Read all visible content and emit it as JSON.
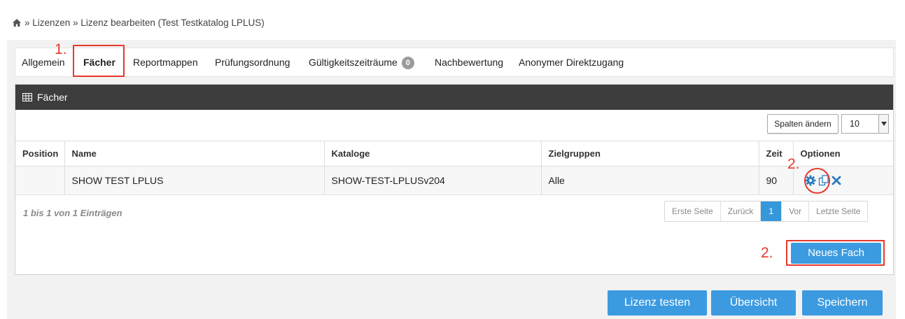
{
  "breadcrumb": {
    "home_icon": "home-icon",
    "text": "» Lizenzen » Lizenz bearbeiten (Test Testkatalog LPLUS)"
  },
  "tabs": [
    {
      "label": "Allgemein"
    },
    {
      "label": "Fächer",
      "active": true
    },
    {
      "label": "Reportmappen"
    },
    {
      "label": "Prüfungsordnung"
    },
    {
      "label": "Gültigkeitszeiträume",
      "badge": "0"
    },
    {
      "label": "Nachbewertung"
    },
    {
      "label": "Anonymer Direktzugang"
    }
  ],
  "annotations": {
    "step1": "1.",
    "step2_options": "2.",
    "step2_button": "2.",
    "color": "#e8382c"
  },
  "panel": {
    "title": "Fächer",
    "title_icon": "table-icon",
    "columns_button": "Spalten ändern",
    "page_size": "10"
  },
  "table": {
    "headers": [
      "Position",
      "Name",
      "Kataloge",
      "Zielgruppen",
      "Zeit",
      "Optionen"
    ],
    "rows": [
      {
        "position": "",
        "name": "SHOW TEST LPLUS",
        "kataloge": "SHOW-TEST-LPLUSv204",
        "zielgruppen": "Alle",
        "zeit": "90",
        "options": [
          "gear-icon",
          "copy-icon",
          "delete-icon"
        ]
      }
    ]
  },
  "info": "1 bis 1 von 1 Einträgen",
  "pagination": {
    "first": "Erste Seite",
    "prev": "Zurück",
    "current": "1",
    "next": "Vor",
    "last": "Letzte Seite"
  },
  "buttons": {
    "new_subject": "Neues Fach",
    "test_license": "Lizenz testen",
    "overview": "Übersicht",
    "save": "Speichern"
  },
  "colors": {
    "primary": "#3c9be0",
    "header_dark": "#3d3d3d",
    "icon_blue": "#2b7bbf"
  }
}
